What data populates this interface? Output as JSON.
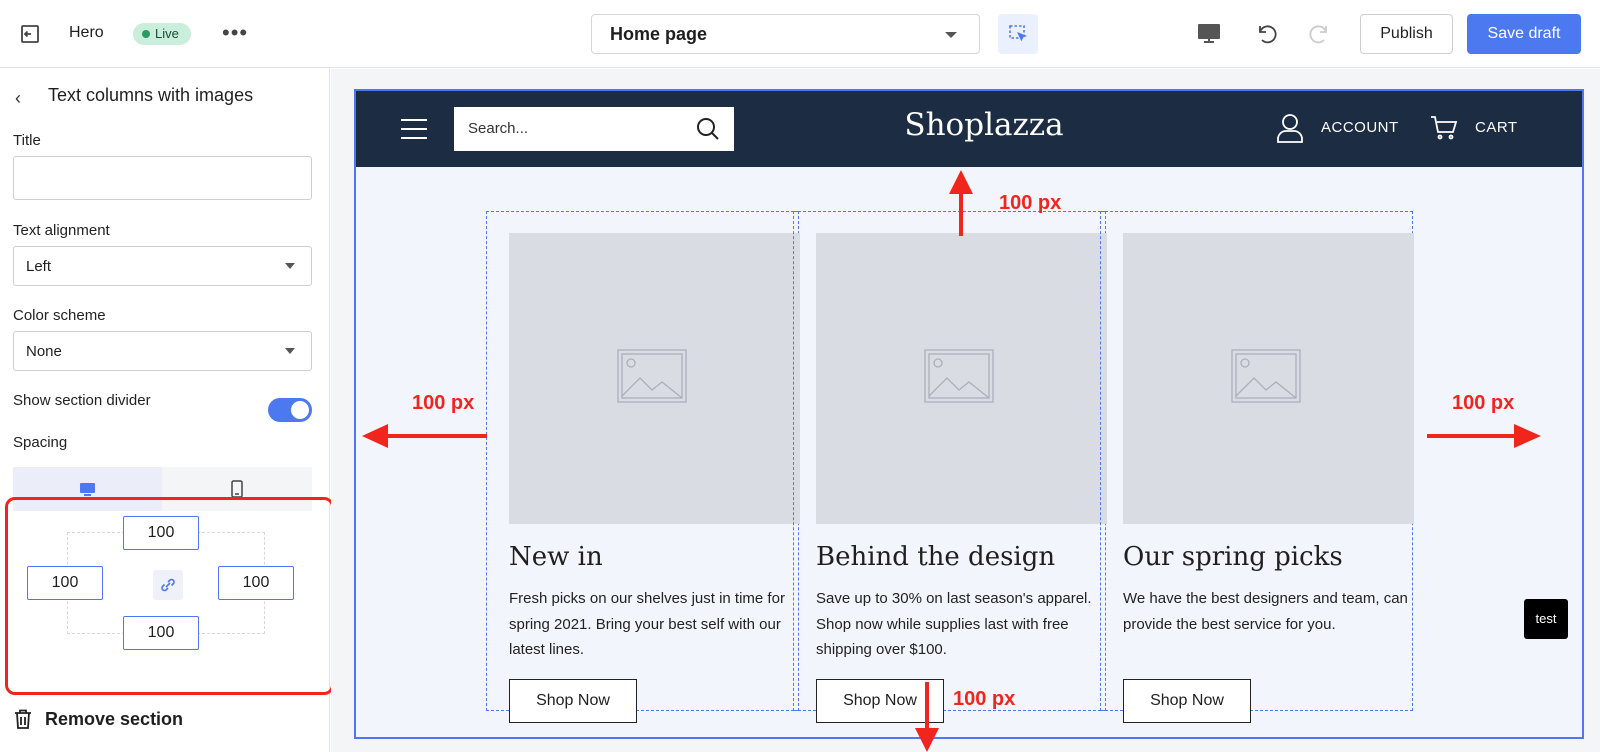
{
  "topbar": {
    "section_name": "Hero",
    "live_badge": "Live",
    "more_label": "•••",
    "page_selector": "Home page",
    "publish_label": "Publish",
    "save_label": "Save draft"
  },
  "sidebar": {
    "title": "Text columns with images",
    "fields": {
      "title_label": "Title",
      "title_value": "",
      "alignment_label": "Text alignment",
      "alignment_value": "Left",
      "color_label": "Color scheme",
      "color_value": "None",
      "divider_label": "Show section divider",
      "divider_on": true,
      "spacing_label": "Spacing"
    },
    "spacing": {
      "top": "100",
      "left": "100",
      "right": "100",
      "bottom": "100"
    },
    "remove_label": "Remove section"
  },
  "store": {
    "search_placeholder": "Search...",
    "logo": "Shoplazza",
    "account": "ACCOUNT",
    "cart": "CART"
  },
  "columns": [
    {
      "heading": "New in",
      "body": "Fresh picks on our shelves just in time for spring 2021. Bring your best self with our latest lines.",
      "button": "Shop Now"
    },
    {
      "heading": "Behind the design",
      "body": "Save up to 30% on last season's apparel. Shop now while supplies last with free shipping over $100.",
      "button": "Shop Now"
    },
    {
      "heading": "Our spring picks",
      "body": "We have the best designers and team, can provide the best service for you.",
      "button": "Shop Now"
    }
  ],
  "annotations": {
    "top": "100 px",
    "left": "100 px",
    "right": "100 px",
    "bottom": "100 px"
  },
  "test_badge": "test",
  "colors": {
    "accent": "#4c78f0",
    "annotation": "#f0261d",
    "header": "#1c2c42"
  }
}
